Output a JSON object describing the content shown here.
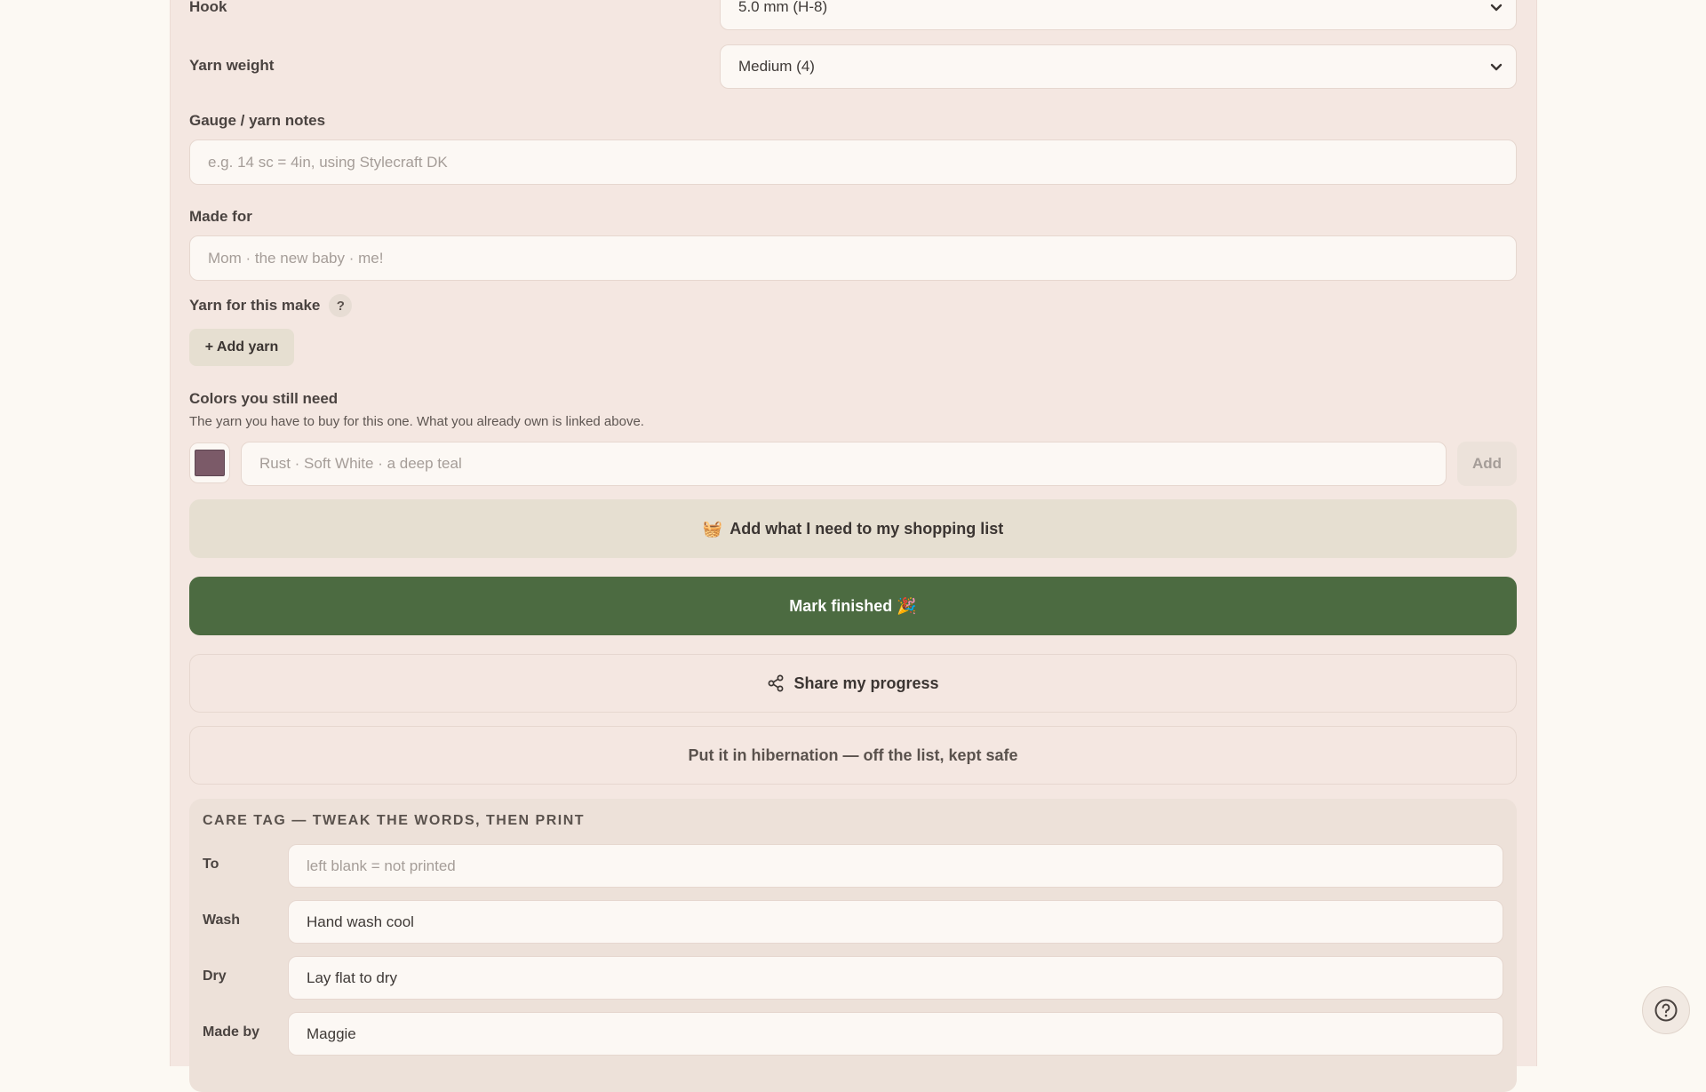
{
  "form": {
    "hook": {
      "label": "Hook",
      "value": "5.0 mm (H-8)"
    },
    "yarn_weight": {
      "label": "Yarn weight",
      "value": "Medium (4)"
    },
    "gauge": {
      "label": "Gauge / yarn notes",
      "placeholder": "e.g. 14 sc = 4in, using Stylecraft DK"
    },
    "made_for": {
      "label": "Made for",
      "placeholder": "Mom · the new baby · me!"
    },
    "yarn_section": {
      "label": "Yarn for this make",
      "help": "?",
      "add_button": "+ Add yarn"
    },
    "colors": {
      "label": "Colors you still need",
      "hint": "The yarn you have to buy for this one. What you already own is linked above.",
      "swatch_color": "#7b5a68",
      "placeholder": "Rust · Soft White · a deep teal",
      "add_button": "Add"
    }
  },
  "actions": {
    "shopping": {
      "icon": "🧺",
      "label": "Add what I need to my shopping list"
    },
    "finish": {
      "label": "Mark finished 🎉"
    },
    "share": {
      "icon": "share-icon",
      "label": "Share my progress"
    },
    "hibernate": {
      "label": "Put it in hibernation — off the list, kept safe"
    }
  },
  "care_tag": {
    "title": "CARE TAG — TWEAK THE WORDS, THEN PRINT",
    "fields": [
      {
        "label": "To",
        "value": "",
        "placeholder": "left blank = not printed"
      },
      {
        "label": "Wash",
        "value": "Hand wash cool",
        "placeholder": ""
      },
      {
        "label": "Dry",
        "value": "Lay flat to dry",
        "placeholder": ""
      },
      {
        "label": "Made by",
        "value": "Maggie",
        "placeholder": ""
      }
    ]
  },
  "help_fab": {
    "icon": "question-circle-icon"
  },
  "colors": {
    "page_bg": "#fcf9f3",
    "panel_bg": "#f4e7e1",
    "accent_green": "#4c6b41",
    "soft_button": "#e6dfd1"
  }
}
